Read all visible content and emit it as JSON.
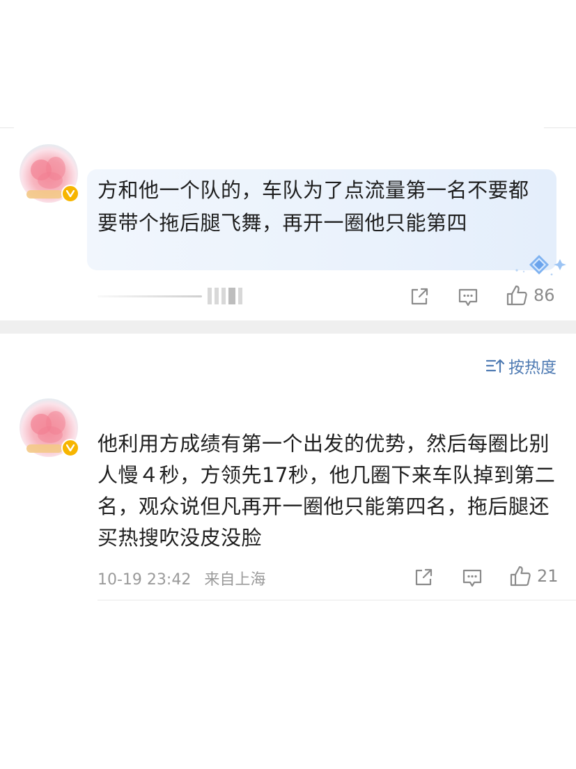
{
  "comment1": {
    "text": "方和他一个队的，车队为了点流量第一名不要都要带个拖后腿飞舞，再开一圈他只能第四",
    "like_count": "86"
  },
  "sort": {
    "label": "按热度"
  },
  "comment2": {
    "text": "他利用方成绩有第一个出发的优势，然后每圈比别人慢４秒，方领先17秒，他几圈下来车队掉到第二名，观众说但凡再开一圈他只能第四名，拖后腿还买热搜吹没皮没脸",
    "date": "10-19 23:42",
    "location": "来自上海",
    "like_count": "21"
  },
  "icons": {
    "share": "share-icon",
    "comment": "comment-icon",
    "like": "thumbs-up-icon",
    "verified": "verified-badge-icon",
    "sort": "sort-icon"
  },
  "colors": {
    "accent": "#4f7bb3",
    "badge": "#f7b500",
    "bubble": "#eaf2fc",
    "muted": "#9a9a9a"
  }
}
